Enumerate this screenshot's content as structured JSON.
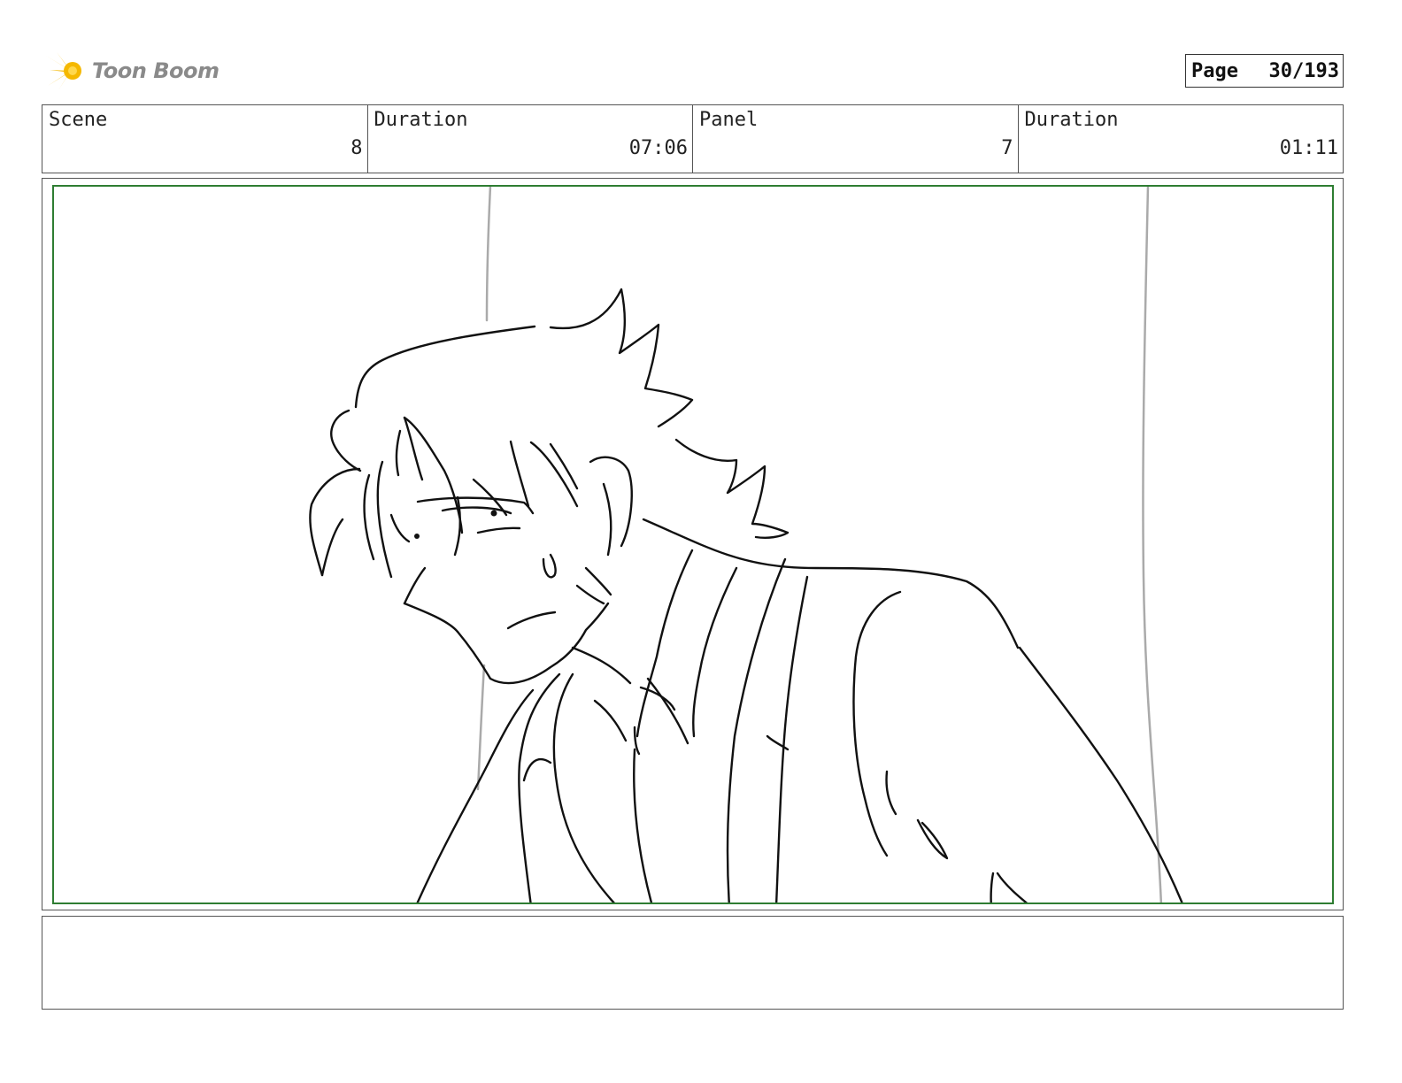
{
  "brand": {
    "name": "Toon Boom",
    "logo_icon": "starburst-icon",
    "logo_color": "#f5b800"
  },
  "page": {
    "label": "Page",
    "value": "30/193"
  },
  "info": {
    "scene_label": "Scene",
    "scene_value": "8",
    "scene_duration_label": "Duration",
    "scene_duration_value": "07:06",
    "panel_label": "Panel",
    "panel_value": "7",
    "panel_duration_label": "Duration",
    "panel_duration_value": "01:11"
  },
  "panel": {
    "safe_frame_color": "#2e7d32",
    "drawing_icon": "character-sketch-icon"
  },
  "notes": {
    "text": ""
  }
}
